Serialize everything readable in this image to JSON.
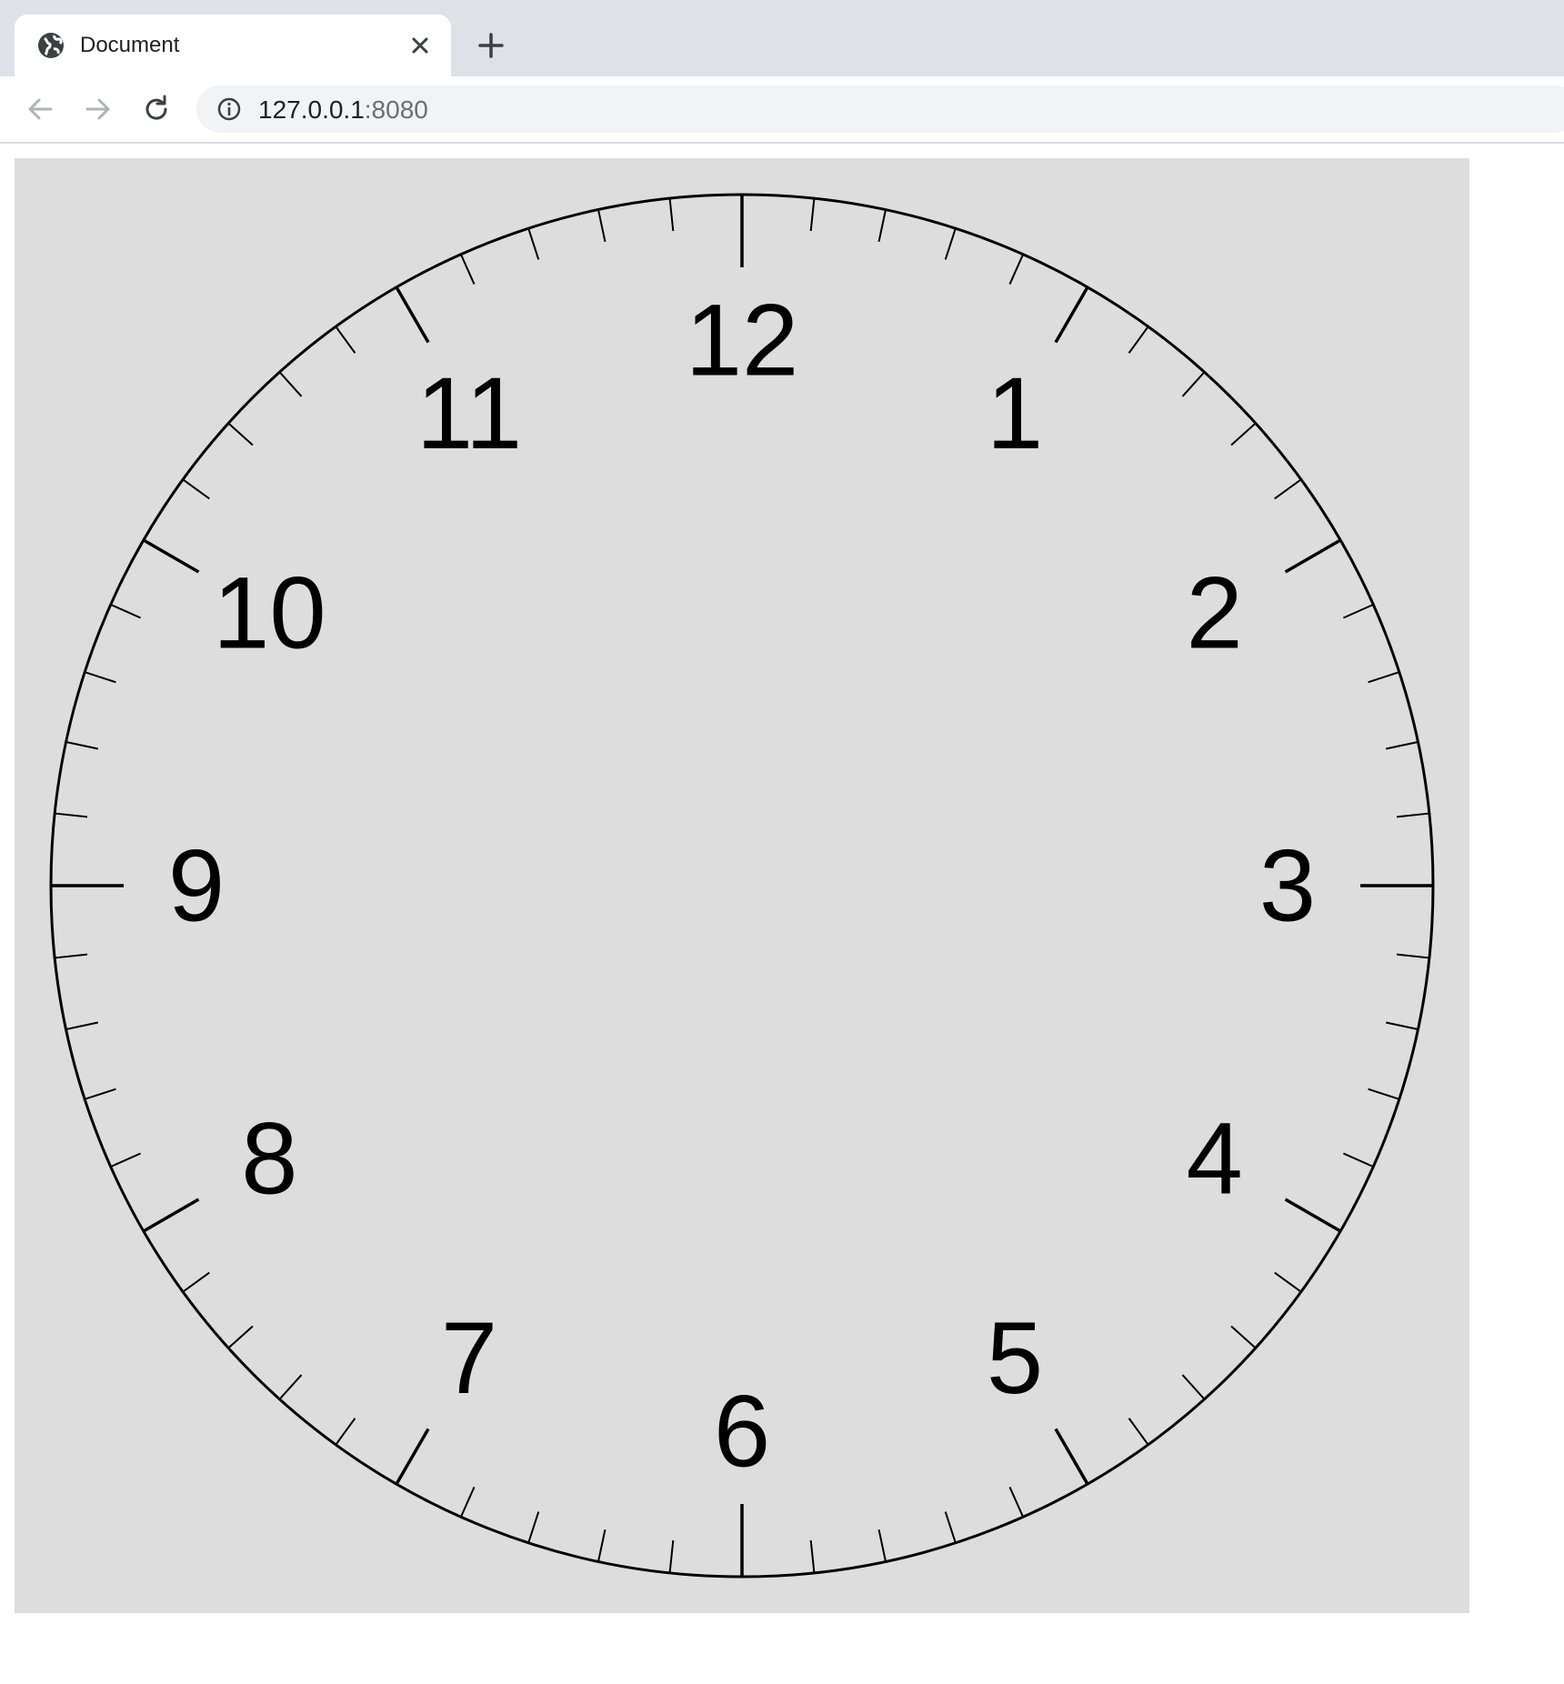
{
  "browser": {
    "tab": {
      "title": "Document",
      "favicon": "globe-icon",
      "close_icon": "close-icon"
    },
    "new_tab_icon": "plus-icon",
    "toolbar": {
      "back_icon": "back-arrow-icon",
      "forward_icon": "forward-arrow-icon",
      "reload_icon": "reload-icon",
      "info_icon": "info-icon"
    },
    "address": {
      "host": "127.0.0.1",
      "port": ":8080"
    }
  },
  "clock": {
    "face_color": "#dddddd",
    "ink_color": "#000000",
    "numerals": [
      "12",
      "1",
      "2",
      "3",
      "4",
      "5",
      "6",
      "7",
      "8",
      "9",
      "10",
      "11"
    ],
    "minute_ticks": 60,
    "hour_ticks": 12
  }
}
